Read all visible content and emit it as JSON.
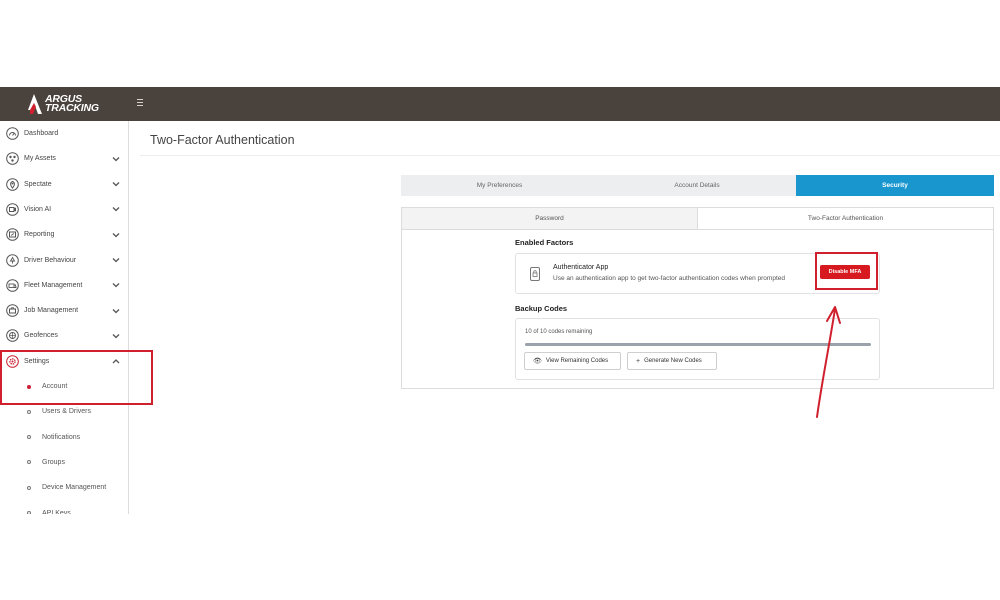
{
  "app": {
    "brand_line1": "ARGUS",
    "brand_line2": "TRACKING"
  },
  "sidebar": {
    "items": [
      {
        "label": "Dashboard",
        "icon": "dashboard-icon",
        "expandable": false
      },
      {
        "label": "My Assets",
        "icon": "assets-icon",
        "expandable": true
      },
      {
        "label": "Spectate",
        "icon": "location-pin-icon",
        "expandable": true
      },
      {
        "label": "Vision AI",
        "icon": "camera-icon",
        "expandable": true
      },
      {
        "label": "Reporting",
        "icon": "report-icon",
        "expandable": true
      },
      {
        "label": "Driver Behaviour",
        "icon": "driver-icon",
        "expandable": true
      },
      {
        "label": "Fleet Management",
        "icon": "fleet-icon",
        "expandable": true
      },
      {
        "label": "Job Management",
        "icon": "job-icon",
        "expandable": true
      },
      {
        "label": "Geofences",
        "icon": "geofence-icon",
        "expandable": true
      },
      {
        "label": "Settings",
        "icon": "settings-gear-icon",
        "expandable": true,
        "expanded": true
      }
    ],
    "settings_sub": [
      {
        "label": "Account",
        "active": true
      },
      {
        "label": "Users & Drivers",
        "active": false
      },
      {
        "label": "Notifications",
        "active": false
      },
      {
        "label": "Groups",
        "active": false
      },
      {
        "label": "Device Management",
        "active": false
      },
      {
        "label": "API Keys",
        "active": false
      }
    ]
  },
  "page": {
    "title": "Two-Factor Authentication"
  },
  "tabs": [
    {
      "label": "My Preferences",
      "active": false
    },
    {
      "label": "Account Details",
      "active": false
    },
    {
      "label": "Security",
      "active": true
    }
  ],
  "subtabs": [
    {
      "label": "Password",
      "active": false
    },
    {
      "label": "Two-Factor Authentication",
      "active": true
    }
  ],
  "enabled_factors": {
    "heading": "Enabled Factors",
    "factor_title": "Authenticator App",
    "factor_desc": "Use an authentication app to get two-factor authentication codes when prompted",
    "disable_label": "Disable MFA"
  },
  "backup_codes": {
    "heading": "Backup Codes",
    "remaining_text": "10 of 10 codes remaining",
    "remaining_fraction": 1.0,
    "view_label": "View Remaining Codes",
    "generate_label": "Generate New Codes"
  },
  "colors": {
    "topbar": "#4a423c",
    "accent_blue": "#1a96cf",
    "danger_red": "#d71920",
    "annotation_red": "#d0202e"
  }
}
